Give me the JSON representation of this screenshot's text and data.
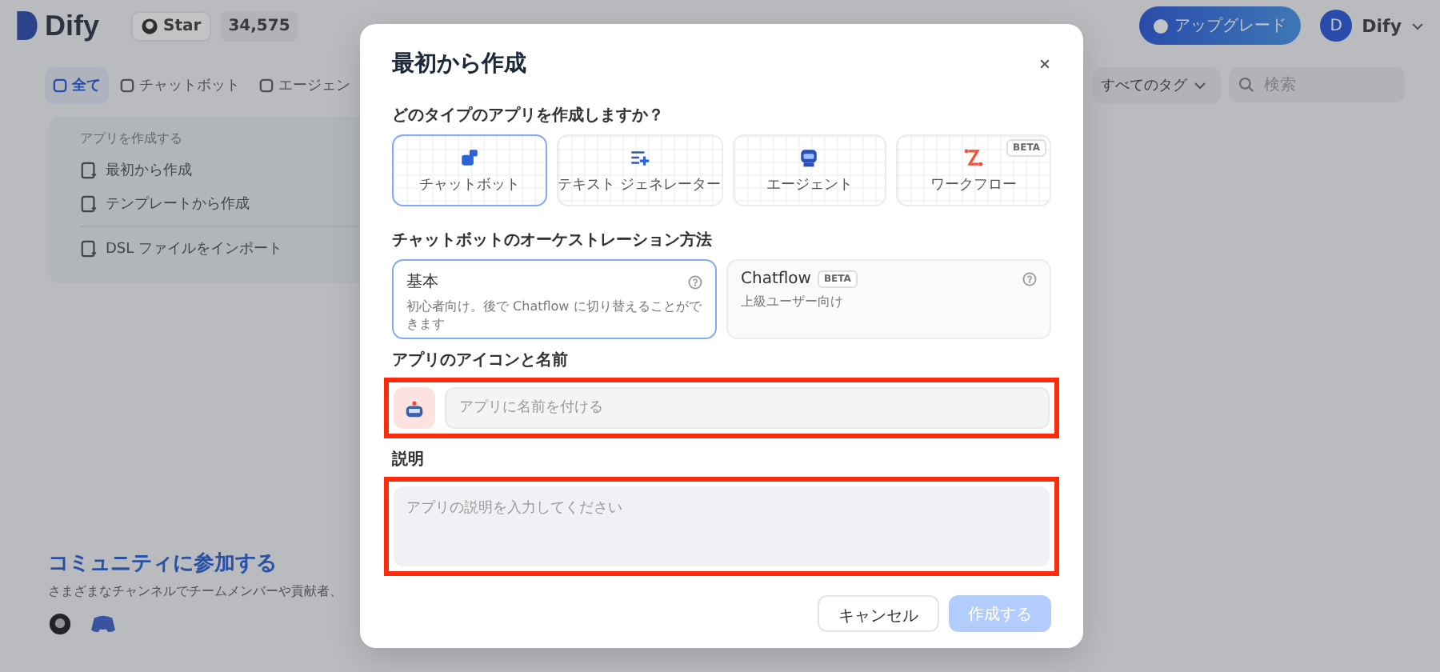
{
  "header": {
    "logo": "Dify",
    "github": {
      "label": "Star",
      "count": "34,575"
    },
    "upgrade": "アップグレード",
    "user": {
      "initial": "D",
      "name": "Dify"
    }
  },
  "filters": {
    "tabs": [
      {
        "label": "全て",
        "selected": true
      },
      {
        "label": "チャットボット",
        "selected": false
      },
      {
        "label": "エージェン",
        "selected": false
      }
    ],
    "tag_select": "すべてのタグ",
    "search": {
      "placeholder": "検索"
    }
  },
  "create_card": {
    "heading": "アプリを作成する",
    "items": [
      {
        "kind": "blank",
        "label": "最初から作成"
      },
      {
        "kind": "template",
        "label": "テンプレートから作成"
      },
      {
        "kind": "import",
        "label": "DSL ファイルをインポート"
      }
    ]
  },
  "community": {
    "title": "コミュニティに参加する",
    "text": "さまざまなチャンネルでチームメンバーや貢献者、"
  },
  "dialog": {
    "title": "最初から作成",
    "type_label": "どのタイプのアプリを作成しますか？",
    "types": [
      {
        "kind": "chatbot",
        "label": "チャットボット",
        "selected": true
      },
      {
        "kind": "text",
        "label": "テキスト ジェネレーター",
        "selected": false
      },
      {
        "kind": "agent",
        "label": "エージェント",
        "selected": false
      },
      {
        "kind": "workflow",
        "label": "ワークフロー",
        "selected": false,
        "badge": "BETA"
      }
    ],
    "mode_label": "チャットボットのオーケストレーション方法",
    "modes": [
      {
        "title": "基本",
        "description": "初心者向け。後で Chatflow に切り替えることができます",
        "selected": true
      },
      {
        "title": "Chatflow",
        "badge": "BETA",
        "description": "上級ユーザー向け",
        "selected": false
      }
    ],
    "name_label": "アプリのアイコンと名前",
    "name_field": {
      "placeholder": "アプリに名前を付ける",
      "highlighted": true
    },
    "description_label": "説明",
    "description_field": {
      "placeholder": "アプリの説明を入力してください",
      "highlighted": true
    },
    "buttons": [
      {
        "kind": "cancel",
        "label": "キャンセル",
        "disabled": false
      },
      {
        "kind": "primary",
        "label": "作成する",
        "disabled": true
      }
    ]
  }
}
